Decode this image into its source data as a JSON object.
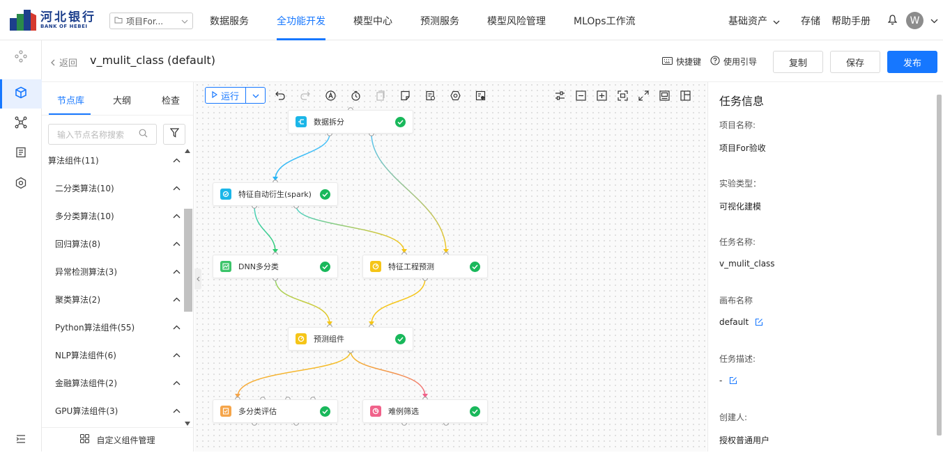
{
  "brand": {
    "name_cn": "河北银行",
    "name_en": "BANK OF HEBEI"
  },
  "project_select": {
    "value": "项目For..."
  },
  "nav": {
    "items": [
      "数据服务",
      "全功能开发",
      "模型中心",
      "预测服务",
      "模型风险管理",
      "MLOps工作流"
    ],
    "active_index": 1
  },
  "top_right": {
    "assets": "基础资产",
    "storage": "存储",
    "help": "帮助手册",
    "avatar_letter": "W"
  },
  "subheader": {
    "back": "返回",
    "title": "v_mulit_class (default)",
    "shortcuts": "快捷键",
    "guide": "使用引导",
    "copy": "复制",
    "save": "保存",
    "publish": "发布"
  },
  "node_panel": {
    "tabs": [
      "节点库",
      "大纲",
      "检查"
    ],
    "active_tab": 0,
    "search_placeholder": "输入节点名称搜索",
    "categories": [
      {
        "label": "算法组件(11)",
        "level": 0
      },
      {
        "label": "二分类算法(10)",
        "level": 1
      },
      {
        "label": "多分类算法(10)",
        "level": 1
      },
      {
        "label": "回归算法(8)",
        "level": 1
      },
      {
        "label": "异常检测算法(3)",
        "level": 1
      },
      {
        "label": "聚类算法(2)",
        "level": 1
      },
      {
        "label": "Python算法组件(55)",
        "level": 1
      },
      {
        "label": "NLP算法组件(6)",
        "level": 1
      },
      {
        "label": "金融算法组件(2)",
        "level": 1
      },
      {
        "label": "GPU算法组件(3)",
        "level": 1
      }
    ],
    "footer": "自定义组件管理"
  },
  "canvas": {
    "run_label": "运行",
    "nodes": [
      {
        "id": "split",
        "label": "数据拆分",
        "icon": "data-split-icon",
        "color": "#1bb6e8",
        "status": "success"
      },
      {
        "id": "feat",
        "label": "特征自动衍生(spark)",
        "icon": "feature-derive-icon",
        "color": "#1bb6e8",
        "status": "success"
      },
      {
        "id": "dnn",
        "label": "DNN多分类",
        "icon": "dnn-icon",
        "color": "#3cc46a",
        "status": "success"
      },
      {
        "id": "featpred",
        "label": "特征工程预测",
        "icon": "feature-predict-icon",
        "color": "#f5c518",
        "status": "success"
      },
      {
        "id": "pred",
        "label": "预测组件",
        "icon": "predict-icon",
        "color": "#f5c518",
        "status": "success"
      },
      {
        "id": "eval",
        "label": "多分类评估",
        "icon": "evaluate-icon",
        "color": "#f5a54a",
        "status": "success"
      },
      {
        "id": "filter",
        "label": "难例筛选",
        "icon": "hard-example-icon",
        "color": "#f0628a",
        "status": "success"
      }
    ]
  },
  "info_panel": {
    "title": "任务信息",
    "fields": [
      {
        "label": "项目名称:",
        "value": "项目For验收",
        "editable": false
      },
      {
        "label": "实验类型：",
        "value": "可视化建模",
        "editable": false
      },
      {
        "label": "任务名称:",
        "value": "v_mulit_class",
        "editable": false
      },
      {
        "label": "画布名称",
        "value": "default",
        "editable": true
      },
      {
        "label": "任务描述:",
        "value": "-",
        "editable": true
      },
      {
        "label": "创建人:",
        "value": "授权普通用户",
        "editable": false
      }
    ]
  },
  "colors": {
    "accent": "#1677ff",
    "success": "#19b85b"
  }
}
